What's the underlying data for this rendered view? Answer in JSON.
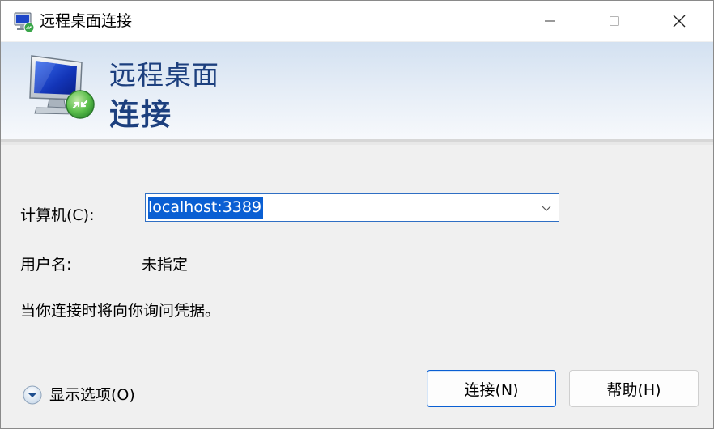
{
  "window": {
    "title": "远程桌面连接",
    "icon": "remote-desktop-icon",
    "controls": [
      "minimize-icon",
      "maximize-icon",
      "close-icon"
    ]
  },
  "banner": {
    "line1": "远程桌面",
    "line2": "连接",
    "icon": "remote-desktop-monitor-icon"
  },
  "form": {
    "computer_label": "计算机(C):",
    "computer_value": "localhost:3389",
    "user_label": "用户名:",
    "user_value": "未指定",
    "prompt": "当你连接时将向你询问凭据。"
  },
  "options": {
    "label_prefix": "显示选项(",
    "label_mnemonic": "O",
    "label_suffix": ")"
  },
  "buttons": {
    "connect": "连接(N)",
    "help": "帮助(H)"
  },
  "colors": {
    "accent": "#0a5fd3",
    "banner_text": "#1c3f7e",
    "selection": "#0a5fd3"
  }
}
